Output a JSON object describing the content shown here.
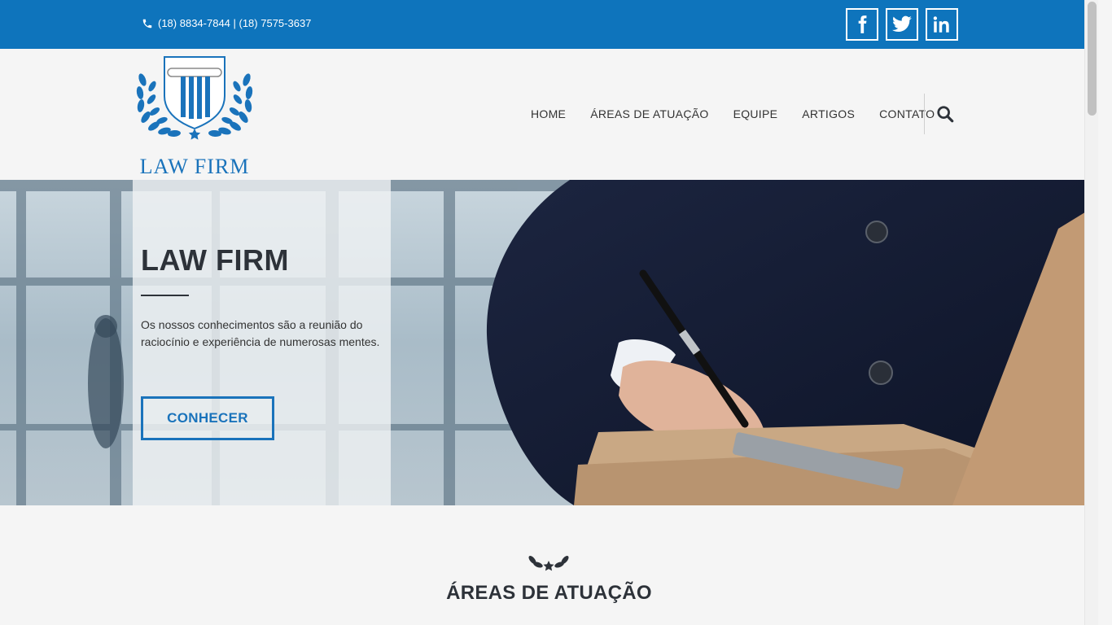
{
  "topbar": {
    "phone_text": "(18) 8834-7844 | (18) 7575-3637",
    "socials": [
      {
        "icon": "facebook-icon",
        "label": "f"
      },
      {
        "icon": "twitter-icon",
        "label": "t"
      },
      {
        "icon": "linkedin-icon",
        "label": "in"
      }
    ]
  },
  "header": {
    "logo_text": "LAW FIRM",
    "nav": [
      "HOME",
      "ÁREAS DE ATUAÇÃO",
      "EQUIPE",
      "ARTIGOS",
      "CONTATO"
    ]
  },
  "hero": {
    "title": "LAW FIRM",
    "text": "Os nossos conhecimentos são a reunião do raciocínio e experiência de numerosas mentes.",
    "button_label": "CONHECER"
  },
  "section": {
    "title": "ÁREAS DE ATUAÇÃO"
  },
  "colors": {
    "brand": "#0e74bc",
    "dark_text": "#2d3239",
    "background": "#f5f5f5"
  }
}
